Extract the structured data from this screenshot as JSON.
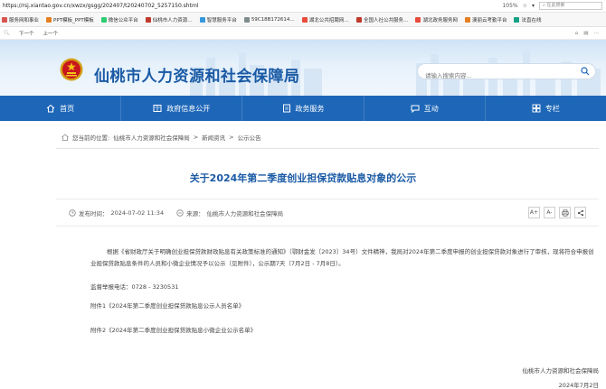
{
  "browser": {
    "url": "https://rsj.xiantao.gov.cn/xwzx/gsgg/202407/t20240702_5257150.shtml",
    "zoom": "105%",
    "search_placeholder": "在此搜索",
    "bookmarks": [
      {
        "label": "服务网和事业",
        "color": "#d9534f"
      },
      {
        "label": "PPT模板_PPT模板",
        "color": "#e67e22"
      },
      {
        "label": "微信公众平台",
        "color": "#2ecc71"
      },
      {
        "label": "仙桃市人力资源…",
        "color": "#c0392b"
      },
      {
        "label": "智慧服务平台",
        "color": "#3498db"
      },
      {
        "label": "59C18B172614…",
        "color": "#7f8c8d"
      },
      {
        "label": "湖北公共招聘网…",
        "color": "#e74c3c"
      },
      {
        "label": "全国人社公共服务…",
        "color": "#c0392b"
      },
      {
        "label": "湖北政务服务网",
        "color": "#e74c3c"
      },
      {
        "label": "澳丽云考勤平台",
        "color": "#e67e22"
      },
      {
        "label": "法直在线",
        "color": "#16a085"
      }
    ],
    "cmd": {
      "prev": "下一个",
      "next": "上一个"
    }
  },
  "site": {
    "title": "仙桃市人力资源和社会保障局",
    "search_placeholder": "请输入搜索内容..."
  },
  "nav": [
    {
      "label": "首页",
      "icon": "home-icon"
    },
    {
      "label": "政府信息公开",
      "icon": "doc-icon"
    },
    {
      "label": "政务服务",
      "icon": "service-icon"
    },
    {
      "label": "互动",
      "icon": "chat-icon"
    },
    {
      "label": "专栏",
      "icon": "column-icon"
    }
  ],
  "breadcrumb": {
    "prefix": "您当前的位置:",
    "items": [
      "仙桃市人力资源和社会保障局",
      "新闻资讯",
      "公示公告"
    ],
    "sep": ">"
  },
  "article": {
    "title": "关于2024年第二季度创业担保贷款贴息对象的公示",
    "date_label": "发布时间：",
    "date": "2024-07-02 11:34",
    "source_label": "来源：",
    "source": "仙桃市人力资源和社会保障局",
    "tools": [
      "A+",
      "A-",
      "print",
      "share"
    ],
    "p1": "根据《省财政厅关于明确创业担保贷款财政贴息有关政策标准的通知》（鄂财金发〔2023〕34号）文件精神，我局对2024年第二季度申报的创业担保贷款对象进行了审核，现将符合申报创业担保贷款贴息条件的人员和小微企业情况予以公示（见附件），公示期7天（7月2日 - 7月8日）。",
    "hotline": "监督举报电话：0728 - 3230531",
    "att1": "附件1《2024年第二季度创业担保贷款贴息公示人员名单》",
    "att2": "附件2《2024年第二季度创业担保贷款贴息小微企业公示名单》",
    "sign_org": "仙桃市人力资源和社会保障局",
    "sign_date": "2024年7月2日"
  }
}
